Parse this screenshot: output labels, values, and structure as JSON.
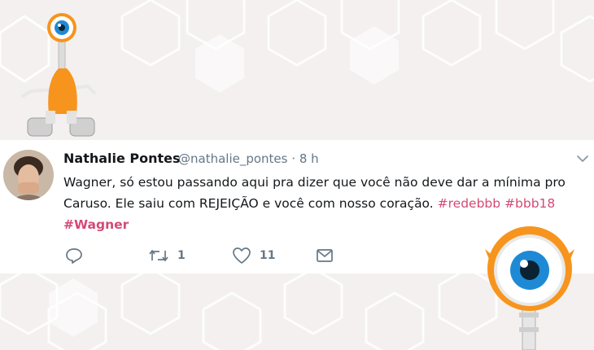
{
  "tweet": {
    "author_name": "Nathalie Pontes",
    "handle": "@nathalie_pontes",
    "separator": "·",
    "time": "8 h",
    "text_parts": [
      "Wagner, só estou passando aqui pra dizer que você não deve dar a mínima pro Caruso. Ele saiu com REJEIÇÃO e você com nosso coração. "
    ],
    "hashtags": [
      "#redebbb",
      "#bbb18",
      "#Wagner"
    ]
  },
  "actions": {
    "reply_icon": "reply-icon",
    "retweet_icon": "retweet-icon",
    "retweet_count": "1",
    "like_icon": "heart-icon",
    "like_count": "11",
    "dm_icon": "envelope-icon"
  },
  "colors": {
    "hashtag": "#d44a75",
    "secondary_text": "#657786",
    "mascot_orange": "#f7941d",
    "eye_blue": "#1e8ad6"
  }
}
